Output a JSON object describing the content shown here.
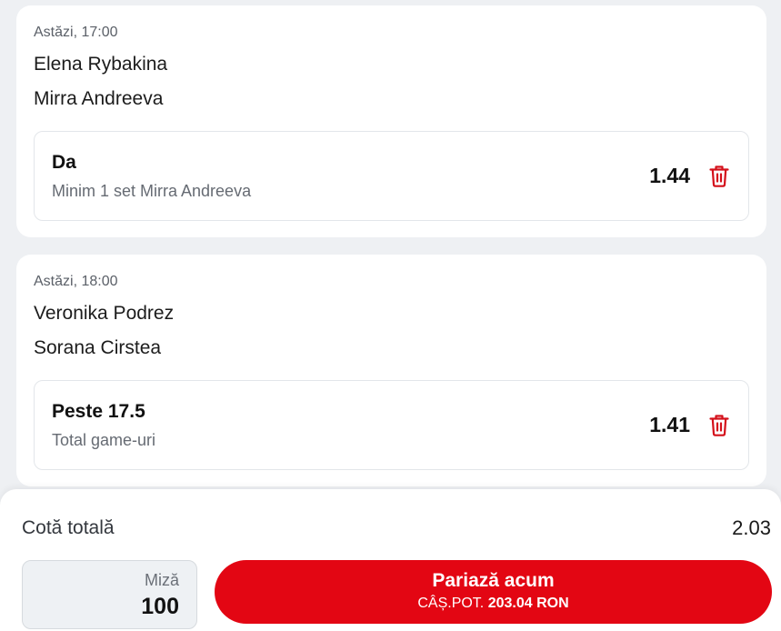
{
  "bets": [
    {
      "time": "Astăzi, 17:00",
      "player1": "Elena Rybakina",
      "player2": "Mirra Andreeva",
      "selection": "Da",
      "market": "Minim 1 set Mirra Andreeva",
      "odds": "1.44"
    },
    {
      "time": "Astăzi, 18:00",
      "player1": "Veronika Podrez",
      "player2": "Sorana Cirstea",
      "selection": "Peste 17.5",
      "market": "Total game-uri",
      "odds": "1.41"
    }
  ],
  "summary": {
    "total_odds_label": "Cotă totală",
    "total_odds_value": "2.03",
    "stake_label": "Miză",
    "stake_value": "100",
    "place_bet_label": "Pariază acum",
    "potential_win_label": "CÂȘ.POT.",
    "potential_win_value": "203.04 RON"
  },
  "colors": {
    "accent": "#e30613",
    "background": "#eef0f3",
    "trash_icon": "#d4101a"
  },
  "icons": {
    "remove": "trash-icon"
  }
}
